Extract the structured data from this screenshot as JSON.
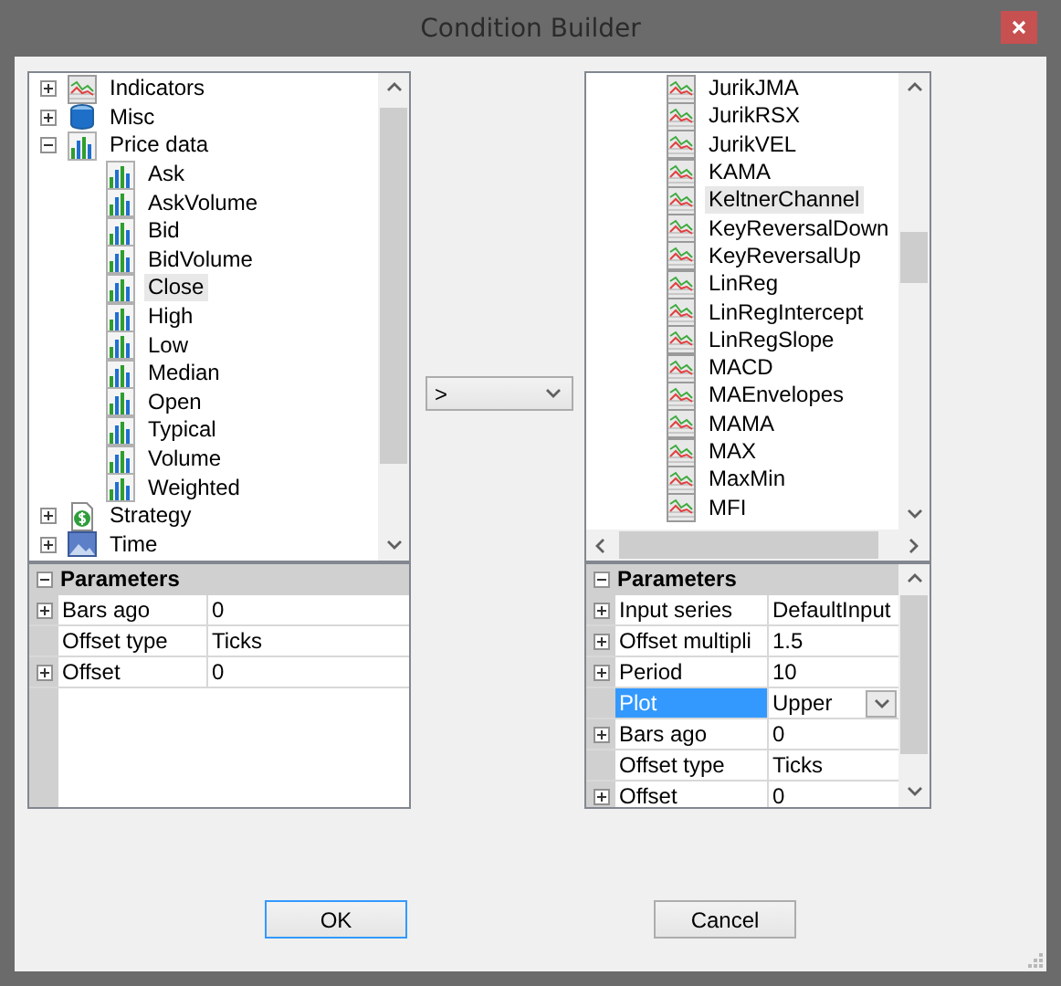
{
  "window": {
    "title": "Condition Builder"
  },
  "left_tree": {
    "items": [
      {
        "label": "Indicators",
        "kind": "indicator",
        "expanded": false,
        "selected": false
      },
      {
        "label": "Misc",
        "kind": "misc",
        "expanded": false,
        "selected": false
      },
      {
        "label": "Price data",
        "kind": "bars",
        "expanded": true,
        "selected": false,
        "children": [
          {
            "label": "Ask",
            "kind": "bars",
            "selected": false
          },
          {
            "label": "AskVolume",
            "kind": "bars",
            "selected": false
          },
          {
            "label": "Bid",
            "kind": "bars",
            "selected": false
          },
          {
            "label": "BidVolume",
            "kind": "bars",
            "selected": false
          },
          {
            "label": "Close",
            "kind": "bars",
            "selected": true
          },
          {
            "label": "High",
            "kind": "bars",
            "selected": false
          },
          {
            "label": "Low",
            "kind": "bars",
            "selected": false
          },
          {
            "label": "Median",
            "kind": "bars",
            "selected": false
          },
          {
            "label": "Open",
            "kind": "bars",
            "selected": false
          },
          {
            "label": "Typical",
            "kind": "bars",
            "selected": false
          },
          {
            "label": "Volume",
            "kind": "bars",
            "selected": false
          },
          {
            "label": "Weighted",
            "kind": "bars",
            "selected": false
          }
        ]
      },
      {
        "label": "Strategy",
        "kind": "strategy",
        "expanded": false,
        "selected": false
      },
      {
        "label": "Time",
        "kind": "time",
        "expanded": false,
        "selected": false
      }
    ]
  },
  "left_parameters": {
    "header": "Parameters",
    "expanded": true,
    "rows": [
      {
        "name": "Bars ago",
        "value": "0",
        "expandable": true,
        "selected": false
      },
      {
        "name": "Offset type",
        "value": "Ticks",
        "expandable": false,
        "selected": false
      },
      {
        "name": "Offset",
        "value": "0",
        "expandable": true,
        "selected": false
      }
    ]
  },
  "operator": {
    "value": ">"
  },
  "right_tree": {
    "items": [
      {
        "label": "JurikJMA",
        "kind": "indicator",
        "selected": false
      },
      {
        "label": "JurikRSX",
        "kind": "indicator",
        "selected": false
      },
      {
        "label": "JurikVEL",
        "kind": "indicator",
        "selected": false
      },
      {
        "label": "KAMA",
        "kind": "indicator",
        "selected": false
      },
      {
        "label": "KeltnerChannel",
        "kind": "indicator",
        "selected": true
      },
      {
        "label": "KeyReversalDown",
        "kind": "indicator",
        "selected": false
      },
      {
        "label": "KeyReversalUp",
        "kind": "indicator",
        "selected": false
      },
      {
        "label": "LinReg",
        "kind": "indicator",
        "selected": false
      },
      {
        "label": "LinRegIntercept",
        "kind": "indicator",
        "selected": false
      },
      {
        "label": "LinRegSlope",
        "kind": "indicator",
        "selected": false
      },
      {
        "label": "MACD",
        "kind": "indicator",
        "selected": false
      },
      {
        "label": "MAEnvelopes",
        "kind": "indicator",
        "selected": false
      },
      {
        "label": "MAMA",
        "kind": "indicator",
        "selected": false
      },
      {
        "label": "MAX",
        "kind": "indicator",
        "selected": false
      },
      {
        "label": "MaxMin",
        "kind": "indicator",
        "selected": false
      },
      {
        "label": "MFI",
        "kind": "indicator",
        "selected": false
      }
    ]
  },
  "right_parameters": {
    "header": "Parameters",
    "expanded": true,
    "rows": [
      {
        "name": "Input series",
        "value": "DefaultInput",
        "expandable": true,
        "selected": false
      },
      {
        "name": "Offset multipli",
        "value": "1.5",
        "expandable": true,
        "selected": false
      },
      {
        "name": "Period",
        "value": "10",
        "expandable": true,
        "selected": false
      },
      {
        "name": "Plot",
        "value": "Upper",
        "expandable": false,
        "selected": true,
        "kind": "dropdown"
      },
      {
        "name": "Bars ago",
        "value": "0",
        "expandable": true,
        "selected": false
      },
      {
        "name": "Offset type",
        "value": "Ticks",
        "expandable": false,
        "selected": false
      },
      {
        "name": "Offset",
        "value": "0",
        "expandable": true,
        "selected": false
      }
    ]
  },
  "buttons": [
    {
      "label": "OK",
      "focused": true
    },
    {
      "label": "Cancel",
      "focused": false
    }
  ]
}
